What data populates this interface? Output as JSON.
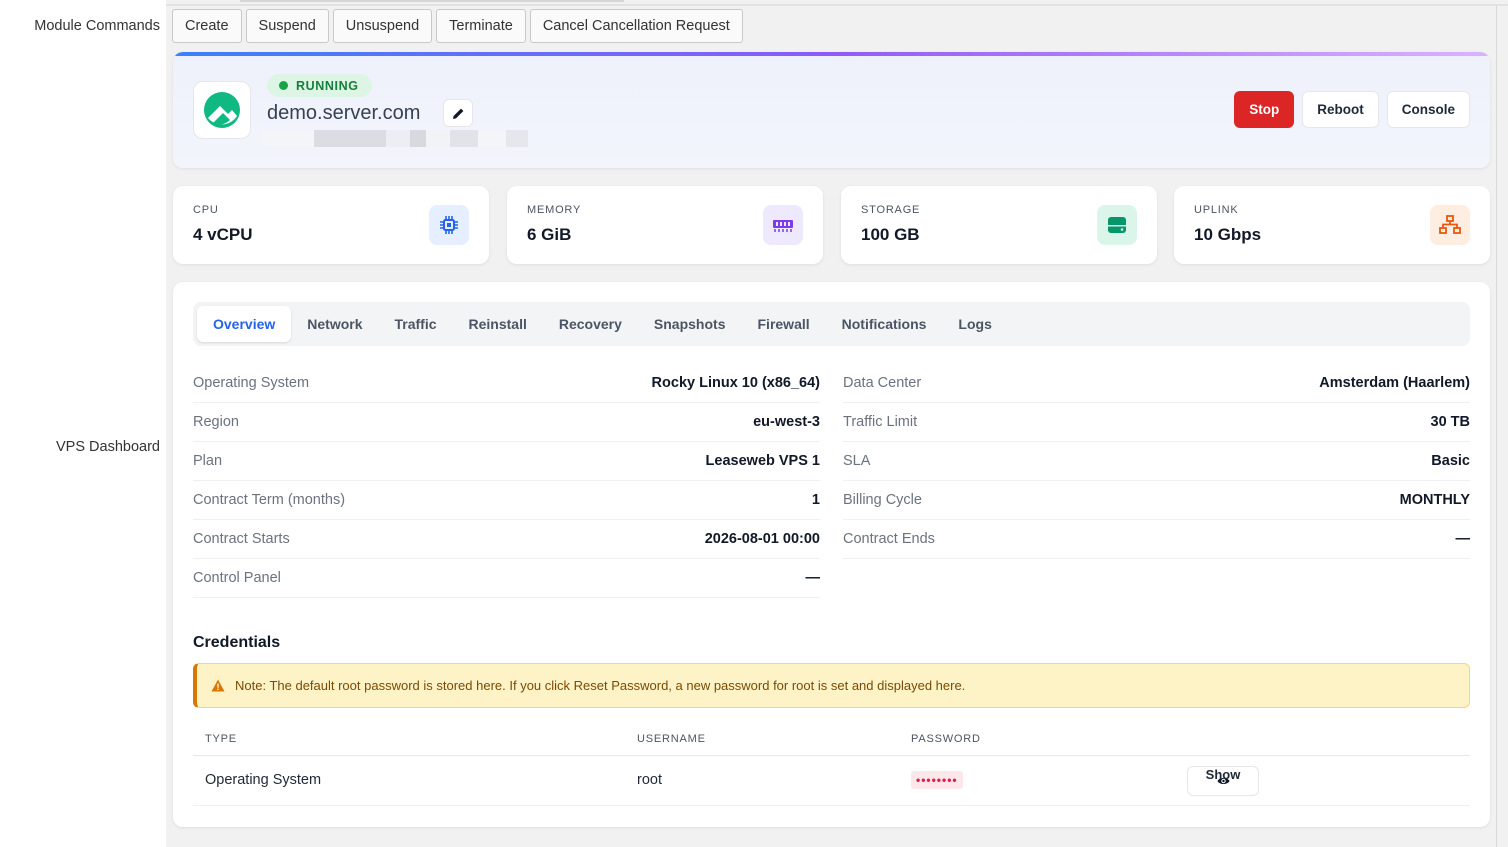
{
  "labels": {
    "module_commands": "Module Commands",
    "vps_dashboard": "VPS Dashboard"
  },
  "commands": [
    "Create",
    "Suspend",
    "Unsuspend",
    "Terminate",
    "Cancel Cancellation Request"
  ],
  "server": {
    "status": "RUNNING",
    "hostname": "demo.server.com",
    "logo_icon": "rocky-linux-logo-icon",
    "edit_icon": "pencil-icon"
  },
  "actions": {
    "stop": "Stop",
    "reboot": "Reboot",
    "console": "Console"
  },
  "stats": [
    {
      "label": "CPU",
      "value": "4 vCPU",
      "icon": "cpu-chip-icon",
      "color": "#2563eb",
      "bg": "#e6efff"
    },
    {
      "label": "MEMORY",
      "value": "6 GiB",
      "icon": "memory-icon",
      "color": "#7c3aed",
      "bg": "#efe9ff"
    },
    {
      "label": "STORAGE",
      "value": "100 GB",
      "icon": "storage-icon",
      "color": "#059669",
      "bg": "#dcf5ea"
    },
    {
      "label": "UPLINK",
      "value": "10 Gbps",
      "icon": "network-icon",
      "color": "#ea580c",
      "bg": "#feeee1"
    }
  ],
  "tabs": [
    "Overview",
    "Network",
    "Traffic",
    "Reinstall",
    "Recovery",
    "Snapshots",
    "Firewall",
    "Notifications",
    "Logs"
  ],
  "info_left": [
    {
      "key": "Operating System",
      "value": "Rocky Linux 10 (x86_64)"
    },
    {
      "key": "Region",
      "value": "eu-west-3"
    },
    {
      "key": "Plan",
      "value": "Leaseweb VPS 1"
    },
    {
      "key": "Contract Term (months)",
      "value": "1"
    },
    {
      "key": "Contract Starts",
      "value": "2026-08-01 00:00"
    },
    {
      "key": "Control Panel",
      "value": "—"
    }
  ],
  "info_right": [
    {
      "key": "Data Center",
      "value": "Amsterdam (Haarlem)"
    },
    {
      "key": "Traffic Limit",
      "value": "30 TB"
    },
    {
      "key": "SLA",
      "value": "Basic"
    },
    {
      "key": "Billing Cycle",
      "value": "MONTHLY"
    },
    {
      "key": "Contract Ends",
      "value": "—"
    }
  ],
  "credentials": {
    "title": "Credentials",
    "note": "Note: The default root password is stored here. If you click Reset Password, a new password for root is set and displayed here.",
    "columns": {
      "type": "TYPE",
      "username": "USERNAME",
      "password": "PASSWORD"
    },
    "rows": [
      {
        "type": "Operating System",
        "username": "root",
        "password": "••••••••",
        "show": "Show"
      }
    ]
  }
}
